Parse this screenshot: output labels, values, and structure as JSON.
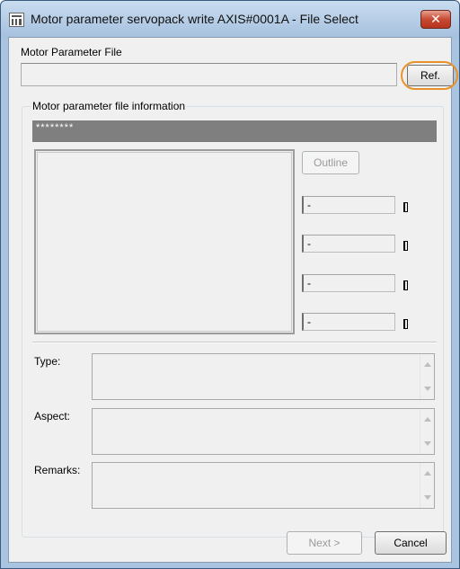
{
  "window": {
    "title": "Motor parameter servopack write AXIS#0001A - File Select",
    "close_label": "✕"
  },
  "file": {
    "label": "Motor Parameter File",
    "value": "",
    "ref_button": "Ref."
  },
  "info": {
    "group_title": "Motor parameter file information",
    "header_text": "********",
    "outline_button": "Outline",
    "values": [
      "-",
      "-",
      "-",
      "-"
    ]
  },
  "fields": {
    "type_label": "Type:",
    "aspect_label": "Aspect:",
    "remarks_label": "Remarks:",
    "type_value": "",
    "aspect_value": "",
    "remarks_value": ""
  },
  "footer": {
    "next_button": "Next >",
    "cancel_button": "Cancel"
  },
  "colors": {
    "highlight_ring": "#e8932a",
    "close_button": "#c74a34"
  }
}
